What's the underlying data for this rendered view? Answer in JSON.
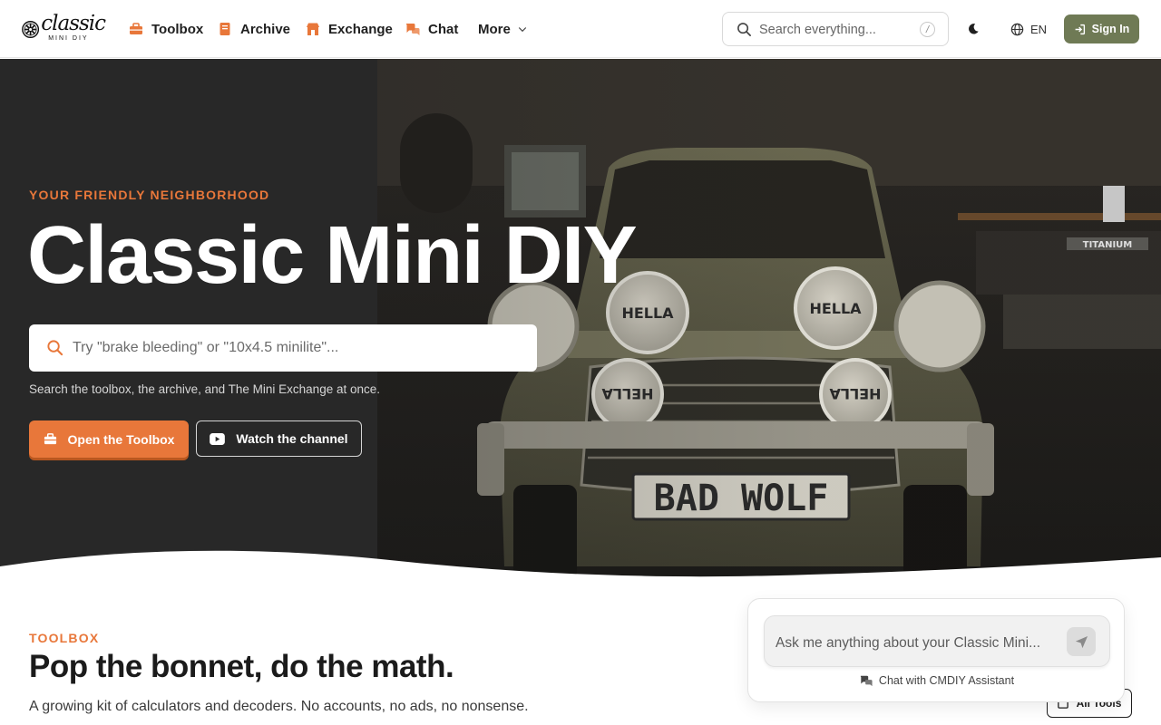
{
  "nav": {
    "logo": {
      "word": "classic",
      "sub": "MINI DIY",
      "icon": "wheel-logo-icon"
    },
    "links": [
      {
        "label": "Toolbox",
        "icon": "toolbox-icon"
      },
      {
        "label": "Archive",
        "icon": "book-icon"
      },
      {
        "label": "Exchange",
        "icon": "store-icon"
      },
      {
        "label": "Chat",
        "icon": "chat-bubbles-icon"
      },
      {
        "label": "More",
        "icon": "chevron-down-icon"
      }
    ],
    "search": {
      "placeholder": "Search everything...",
      "shortcut": "/"
    },
    "theme_icon": "moon-icon",
    "language": "EN",
    "signin_label": "Sign In"
  },
  "hero": {
    "eyebrow": "YOUR FRIENDLY NEIGHBORHOOD",
    "title": "Classic Mini DIY",
    "search_placeholder": "Try \"brake bleeding\" or \"10x4.5 minilite\"...",
    "hint": "Search the toolbox, the archive, and The Mini Exchange at once.",
    "primary_cta": "Open the Toolbox",
    "secondary_cta": "Watch the channel",
    "photo": {
      "plate": "BAD WOLF",
      "lamp_brand": "HELLA",
      "shelf_label": "TITANIUM"
    }
  },
  "toolbox": {
    "eyebrow": "TOOLBOX",
    "title": "Pop the bonnet, do the math.",
    "description": "A growing kit of calculators and decoders. No accounts, no ads, no nonsense."
  },
  "chat_widget": {
    "placeholder": "Ask me anything about your Classic Mini...",
    "caption": "Chat with CMDIY Assistant"
  },
  "all_tools_label": "All Tools",
  "colors": {
    "accent": "#e8773a",
    "signin": "#6f7a55",
    "hero_bg": "#2b2b2b"
  }
}
